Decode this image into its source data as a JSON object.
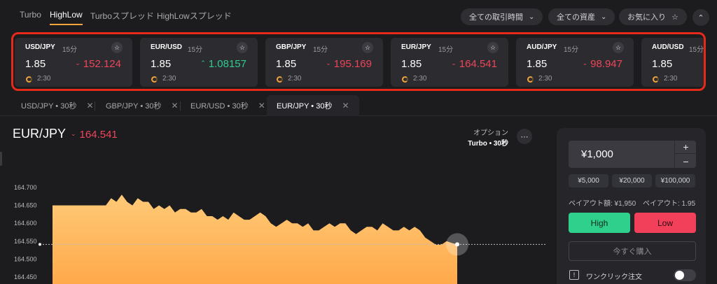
{
  "nav": {
    "tabs": [
      "Turbo",
      "HighLow",
      "Turboスプレッド",
      "HighLowスプレッド"
    ],
    "active_tab": "HighLow",
    "filters": [
      {
        "label": "全ての取引時間",
        "icon": "chevron-down-icon"
      },
      {
        "label": "全ての資産",
        "icon": "chevron-down-icon"
      },
      {
        "label": "お気に入り",
        "icon": "star-icon"
      }
    ]
  },
  "tickers": [
    {
      "pair": "USD/JPY",
      "period": "15分",
      "payout": "1.85",
      "price": "152.124",
      "direction": "down",
      "timer": "2:30"
    },
    {
      "pair": "EUR/USD",
      "period": "15分",
      "payout": "1.85",
      "price": "1.08157",
      "direction": "up",
      "timer": "2:30"
    },
    {
      "pair": "GBP/JPY",
      "period": "15分",
      "payout": "1.85",
      "price": "195.169",
      "direction": "down",
      "timer": "2:30"
    },
    {
      "pair": "EUR/JPY",
      "period": "15分",
      "payout": "1.85",
      "price": "164.541",
      "direction": "down",
      "timer": "2:30"
    },
    {
      "pair": "AUD/JPY",
      "period": "15分",
      "payout": "1.85",
      "price": "98.947",
      "direction": "down",
      "timer": "2:30"
    },
    {
      "pair": "AUD/USD",
      "period": "15分",
      "payout": "1.85",
      "price": "",
      "direction": "",
      "timer": "2:30"
    }
  ],
  "chart_tabs": [
    {
      "label": "USD/JPY • 30秒",
      "active": false
    },
    {
      "label": "GBP/JPY • 30秒",
      "active": false
    },
    {
      "label": "EUR/USD • 30秒",
      "active": false
    },
    {
      "label": "EUR/JPY • 30秒",
      "active": true
    }
  ],
  "asset": {
    "name": "EUR/JPY",
    "price": "164.541",
    "direction": "down"
  },
  "option": {
    "label": "オプション",
    "type": "Turbo • 30秒"
  },
  "chart_data": {
    "type": "area",
    "yticks": [
      "164.700",
      "164.650",
      "164.600",
      "164.550",
      "164.500",
      "164.450"
    ],
    "ylim": [
      164.45,
      164.7
    ],
    "current_price": 164.541,
    "values": [
      164.65,
      164.65,
      164.65,
      164.65,
      164.65,
      164.65,
      164.65,
      164.65,
      164.65,
      164.65,
      164.65,
      164.67,
      164.66,
      164.68,
      164.66,
      164.65,
      164.67,
      164.66,
      164.66,
      164.64,
      164.65,
      164.64,
      164.65,
      164.63,
      164.64,
      164.64,
      164.63,
      164.63,
      164.64,
      164.62,
      164.62,
      164.61,
      164.62,
      164.61,
      164.63,
      164.62,
      164.61,
      164.61,
      164.62,
      164.63,
      164.62,
      164.6,
      164.59,
      164.6,
      164.61,
      164.6,
      164.6,
      164.59,
      164.6,
      164.58,
      164.58,
      164.59,
      164.6,
      164.59,
      164.6,
      164.6,
      164.58,
      164.57,
      164.58,
      164.59,
      164.59,
      164.58,
      164.6,
      164.59,
      164.58,
      164.58,
      164.59,
      164.58,
      164.59,
      164.58,
      164.56,
      164.55,
      164.54,
      164.54,
      164.55,
      164.545,
      164.541
    ]
  },
  "trade": {
    "amount": "¥1,000",
    "presets": [
      "¥5,000",
      "¥20,000",
      "¥100,000"
    ],
    "payout_amount": "ペイアウト額: ¥1,950",
    "payout_rate": "ペイアウト: 1.95",
    "high": "High",
    "low": "Low",
    "buy_now": "今すぐ購入",
    "one_click": "ワンクリック注文",
    "one_click_enabled": false
  }
}
